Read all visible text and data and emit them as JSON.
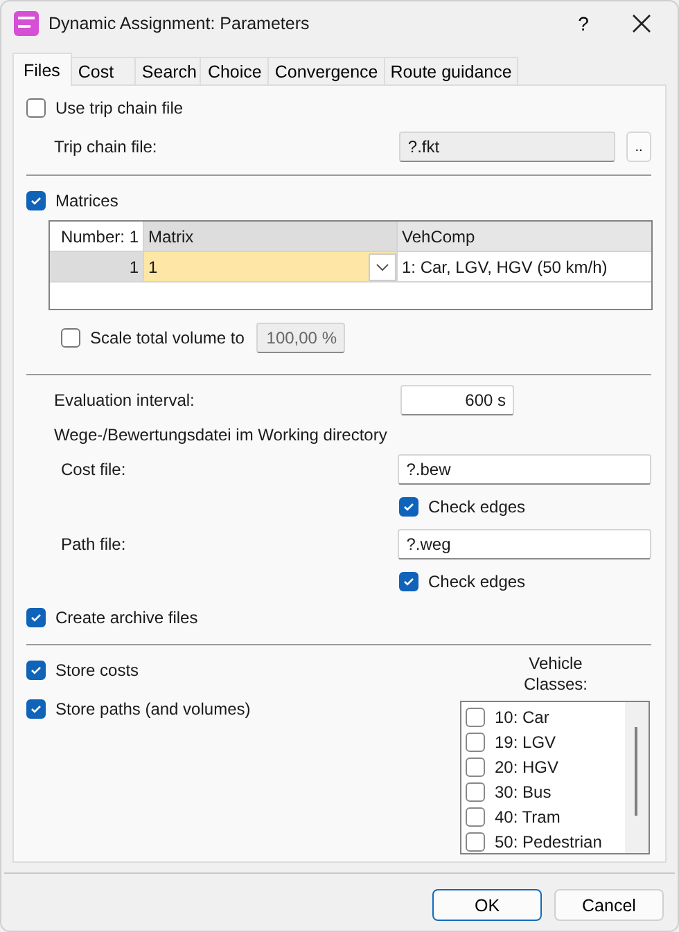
{
  "window": {
    "title": "Dynamic Assignment: Parameters",
    "help": "?"
  },
  "tabs": [
    {
      "label": "Files",
      "selected": true
    },
    {
      "label": "Cost",
      "selected": false
    },
    {
      "label": "Search",
      "selected": false
    },
    {
      "label": "Choice",
      "selected": false
    },
    {
      "label": "Convergence",
      "selected": false
    },
    {
      "label": "Route guidance",
      "selected": false
    }
  ],
  "use_trip_chain_file": {
    "label": "Use trip chain file",
    "checked": false
  },
  "trip_chain_file": {
    "label": "Trip chain file:",
    "value": "?.fkt",
    "browse": ".."
  },
  "matrices": {
    "label": "Matrices",
    "checked": true
  },
  "matrix_table": {
    "columns": [
      "Number: 1",
      "Matrix",
      "VehComp"
    ],
    "rows": [
      {
        "cells": [
          "1",
          "1",
          "1: Car, LGV, HGV (50 km/h)"
        ]
      }
    ]
  },
  "scale_total_volume": {
    "label": "Scale total volume to",
    "checked": false,
    "value": "100,00 %"
  },
  "evaluation_interval": {
    "label": "Evaluation interval:",
    "value": "600 s"
  },
  "working_directory_heading": "Wege-/Bewertungsdatei im Working directory",
  "files": [
    {
      "label": "Cost file:",
      "value": "?.bew",
      "check_edges": {
        "label": "Check edges",
        "checked": true
      }
    },
    {
      "label": "Path file:",
      "value": "?.weg",
      "check_edges": {
        "label": "Check edges",
        "checked": true
      }
    }
  ],
  "create_archive_files": {
    "label": "Create archive files",
    "checked": true
  },
  "store_options": [
    {
      "label": "Store costs",
      "checked": true
    },
    {
      "label": "Store paths (and volumes)",
      "checked": true
    }
  ],
  "vehicle_classes": {
    "label": "Vehicle Classes:",
    "items": [
      {
        "label": "10: Car",
        "checked": false
      },
      {
        "label": "19: LGV",
        "checked": false
      },
      {
        "label": "20: HGV",
        "checked": false
      },
      {
        "label": "30: Bus",
        "checked": false
      },
      {
        "label": "40: Tram",
        "checked": false
      },
      {
        "label": "50: Pedestrian",
        "checked": false
      }
    ]
  },
  "buttons": [
    {
      "label": "OK",
      "kind": "default"
    },
    {
      "label": "Cancel",
      "kind": "normal"
    }
  ]
}
